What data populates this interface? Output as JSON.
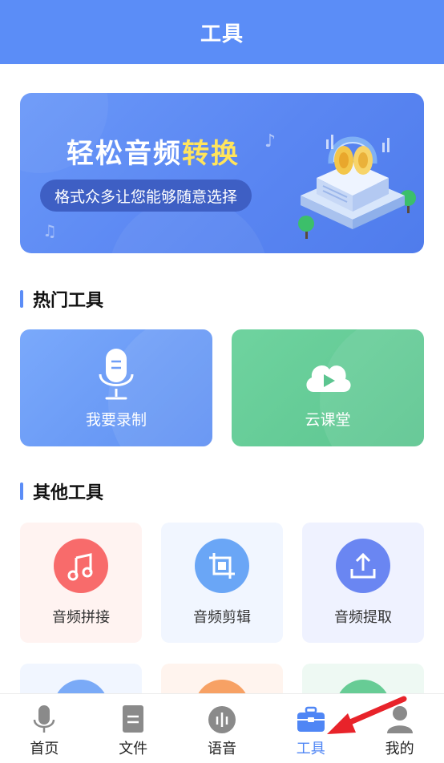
{
  "header": {
    "title": "工具"
  },
  "banner": {
    "title_main": "轻松音频",
    "title_highlight": "转换",
    "subtitle": "格式众多让您能够随意选择",
    "note_glyph_1": "♪",
    "note_glyph_2": "♫"
  },
  "sections": {
    "hot": "热门工具",
    "other": "其他工具"
  },
  "hot_tools": [
    {
      "label": "我要录制",
      "icon": "microphone-icon"
    },
    {
      "label": "云课堂",
      "icon": "cloud-play-icon"
    }
  ],
  "other_tools": [
    {
      "label": "音频拼接",
      "icon": "music-note-icon",
      "color": "#f86b6b"
    },
    {
      "label": "音频剪辑",
      "icon": "crop-icon",
      "color": "#6aa6f6"
    },
    {
      "label": "音频提取",
      "icon": "upload-icon",
      "color": "#6a86f2"
    }
  ],
  "tabbar": [
    {
      "label": "首页",
      "icon": "microphone-icon",
      "active": false
    },
    {
      "label": "文件",
      "icon": "file-icon",
      "active": false
    },
    {
      "label": "语音",
      "icon": "voice-icon",
      "active": false
    },
    {
      "label": "工具",
      "icon": "toolbox-icon",
      "active": true
    },
    {
      "label": "我的",
      "icon": "user-icon",
      "active": false
    }
  ],
  "colors": {
    "primary": "#5b8df7",
    "active_tab": "#4f86f5",
    "inactive_tab_icon": "#8a8a8a",
    "highlight": "#ffe45c",
    "annotation_arrow": "#e8232a"
  }
}
